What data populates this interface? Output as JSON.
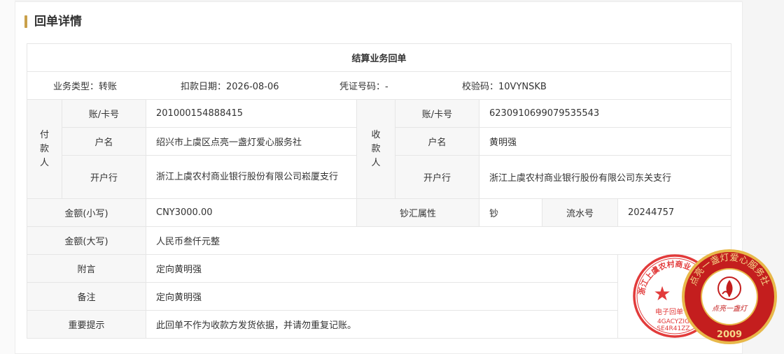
{
  "page": {
    "title": "回单详情"
  },
  "receipt": {
    "heading": "结算业务回单",
    "info": {
      "type_label": "业务类型：",
      "type_value": "转账",
      "date_label": "扣款日期：",
      "date_value": "2026-08-06",
      "voucher_label": "凭证号码：",
      "voucher_value": "-",
      "check_label": "校验码：",
      "check_value": "10VYNSKB"
    },
    "payer": {
      "side_label": "付款人",
      "account_label": "账/卡号",
      "account_value": "201000154888415",
      "name_label": "户名",
      "name_value": "绍兴市上虞区点亮一盏灯爱心服务社",
      "bank_label": "开户行",
      "bank_value": "浙江上虞农村商业银行股份有限公司崧厦支行"
    },
    "payee": {
      "side_label": "收款人",
      "account_label": "账/卡号",
      "account_value": "6230910699079535543",
      "name_label": "户名",
      "name_value": "黄明强",
      "bank_label": "开户行",
      "bank_value": "浙江上虞农村商业银行股份有限公司东关支行"
    },
    "amount_small_label": "金额(小写)",
    "amount_small_value": "CNY3000.00",
    "fx_label": "钞汇属性",
    "fx_value": "钞",
    "serial_label": "流水号",
    "serial_value": "20244757",
    "amount_big_label": "金额(大写)",
    "amount_big_value": "人民币叁仟元整",
    "postscript_label": "附言",
    "postscript_value": "定向黄明强",
    "remark_label": "备注",
    "remark_value": "定向黄明强",
    "notice_label": "重要提示",
    "notice_value": "此回单不作为收款方发货依据，并请勿重复记账。"
  },
  "seals": {
    "bank_seal": {
      "arc_text": "浙江上虞农村商业银行股份",
      "center_text": "电子回单专用",
      "code_line1": "4GACYZIG",
      "code_line2": "SE4R41ZZ",
      "color": "#e23b3b"
    },
    "org_seal": {
      "arc_text": "点亮一盏灯爱心服务社",
      "center_text": "点亮一盏灯",
      "year": "2009",
      "color": "#c41e1e",
      "ring_color": "#e8b84a"
    }
  }
}
